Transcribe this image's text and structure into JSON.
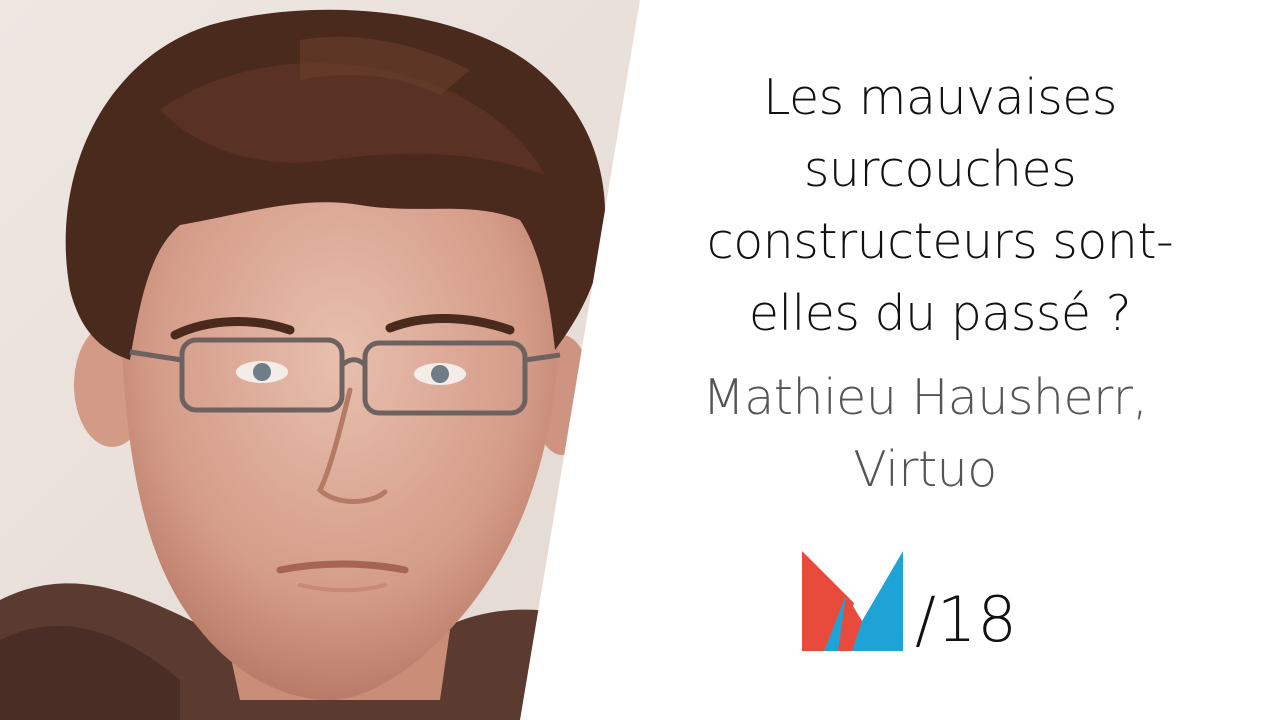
{
  "title_lines": [
    "Les mauvaises",
    "surcouches",
    "constructeurs sont-",
    "elles du passé ?"
  ],
  "speaker": {
    "name": "Mathieu Hausherr,",
    "company": "Virtuo"
  },
  "edition": "/18",
  "colors": {
    "logo_red": "#e84b3c",
    "logo_blue": "#1ea3d6",
    "speaker_text": "#555555"
  }
}
